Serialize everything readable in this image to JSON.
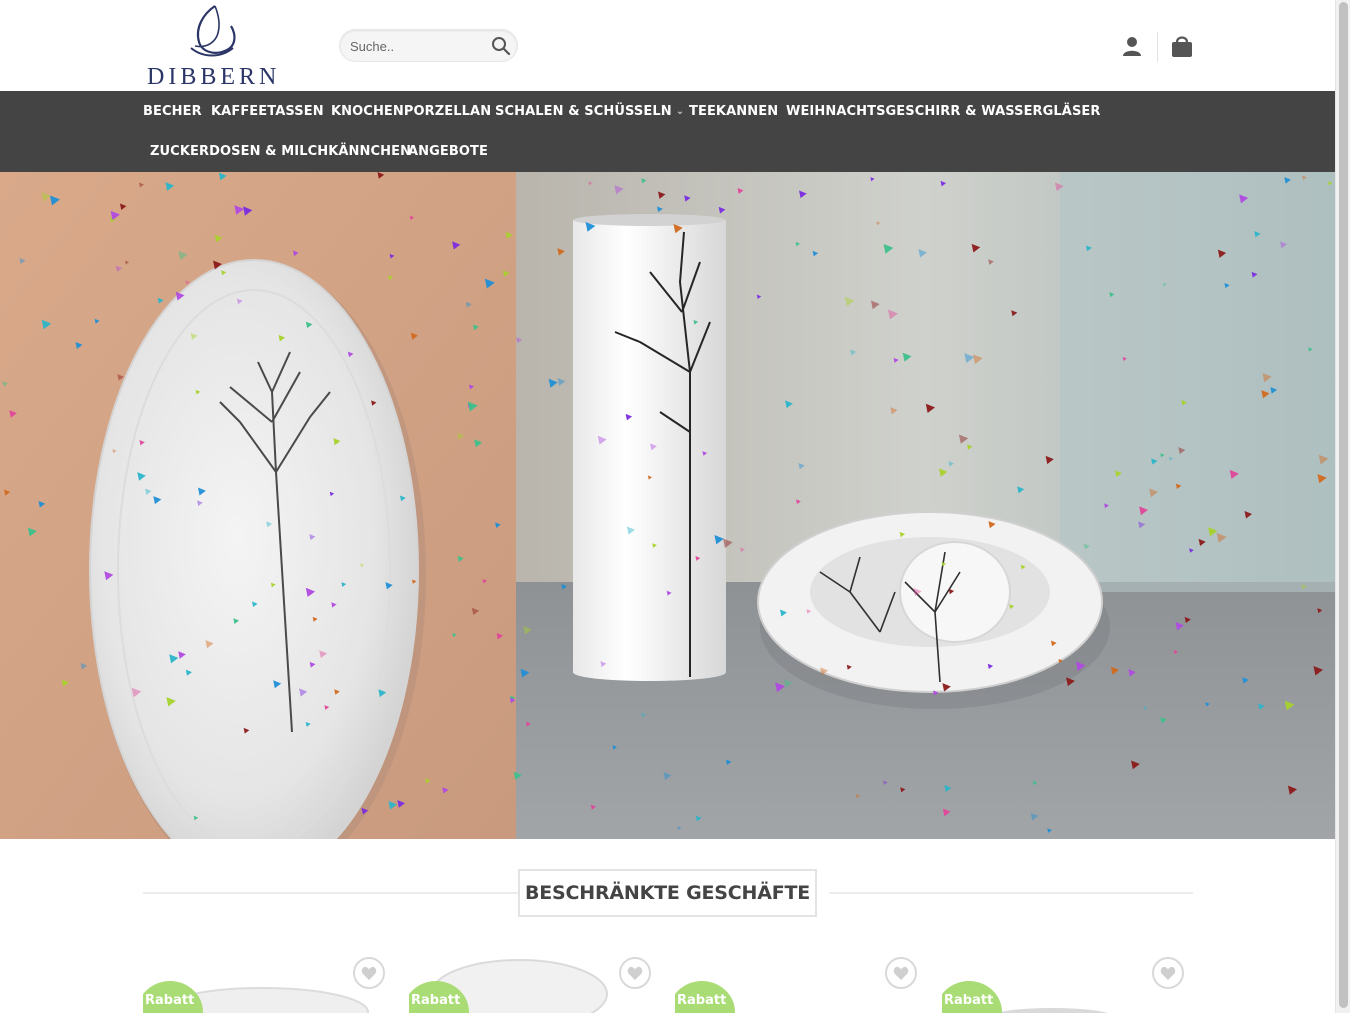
{
  "brand": {
    "name": "DIBBERN"
  },
  "search": {
    "placeholder": "Suche..",
    "button_icon": "search-icon"
  },
  "header_icons": {
    "account": "user-icon",
    "cart": "cart-icon"
  },
  "nav": {
    "items": [
      {
        "label": "BECHER",
        "has_dropdown": false
      },
      {
        "label": "KAFFEETASSEN",
        "has_dropdown": false
      },
      {
        "label": "KNOCHENPORZELLAN",
        "has_dropdown": false
      },
      {
        "label": "SCHALEN & SCHÜSSELN",
        "has_dropdown": true
      },
      {
        "label": "TEEKANNEN",
        "has_dropdown": false
      },
      {
        "label": "WEIHNACHTSGESCHIRR & WASSERGLÄSER",
        "has_dropdown": false
      },
      {
        "label": "ZUCKERDOSEN & MILCHKÄNNCHEN",
        "has_dropdown": false
      },
      {
        "label": "ANGEBOTE",
        "has_dropdown": false
      }
    ]
  },
  "section": {
    "title": "BESCHRÄNKTE GESCHÄFTE"
  },
  "products": [
    {
      "badge": "Rabatt",
      "wishlist_icon": "heart-icon"
    },
    {
      "badge": "Rabatt",
      "wishlist_icon": "heart-icon"
    },
    {
      "badge": "Rabatt",
      "wishlist_icon": "heart-icon"
    },
    {
      "badge": "Rabatt",
      "wishlist_icon": "heart-icon"
    }
  ],
  "colors": {
    "nav_background": "#444444",
    "brand": "#2b3667",
    "badge": "#a9dc74"
  }
}
